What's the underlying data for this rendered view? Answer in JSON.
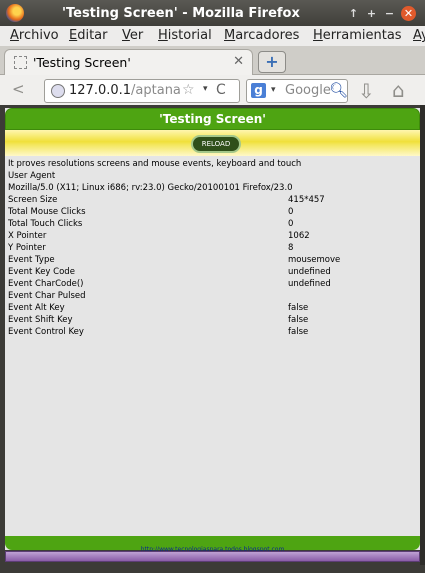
{
  "window": {
    "title": "'Testing Screen' - Mozilla Firefox",
    "buttons": [
      "↑",
      "+",
      "−",
      "✕"
    ]
  },
  "menu": [
    "Archivo",
    "Editar",
    "Ver",
    "Historial",
    "Marcadores",
    "Herramientas",
    "Ay"
  ],
  "tab": {
    "label": "'Testing Screen'",
    "close": "✕",
    "new_tab": "+"
  },
  "nav": {
    "back": "<",
    "url_host": "127.0.0.1",
    "url_path": "/aptana",
    "star": "☆",
    "dropdown": "▾",
    "reload": "C",
    "search_engine": "g",
    "search_placeholder": "Google",
    "search_icon": "magnifier-icon",
    "download_icon": "⇩",
    "home_icon": "⌂"
  },
  "page": {
    "title": "'Testing Screen'",
    "reload_button": "RELOAD",
    "description": "It proves resolutions screens and mouse events, keyboard and touch",
    "user_agent_label": "User Agent",
    "user_agent": "Mozilla/5.0 (X11; Linux i686; rv:23.0) Gecko/20100101 Firefox/23.0",
    "rows": [
      {
        "key": "Screen Size",
        "value": "415*457"
      },
      {
        "key": "Total Mouse Clicks",
        "value": "0"
      },
      {
        "key": "Total Touch Clicks",
        "value": "0"
      },
      {
        "key": "X Pointer",
        "value": "1062"
      },
      {
        "key": "Y Pointer",
        "value": "8"
      },
      {
        "key": "Event Type",
        "value": "mousemove"
      },
      {
        "key": "Event Key Code",
        "value": "undefined"
      },
      {
        "key": "Event CharCode()",
        "value": "undefined"
      },
      {
        "key": "Event Char Pulsed",
        "value": ""
      },
      {
        "key": "Event Alt Key",
        "value": "false"
      },
      {
        "key": "Event Shift Key",
        "value": "false"
      },
      {
        "key": "Event Control Key",
        "value": "false"
      }
    ],
    "footer_link": "http://www.tecnologiaspara.todos.blogspot.com"
  },
  "colors": {
    "header_green": "#4ea412",
    "header_yellow": "#f0e03a",
    "content_bg": "#e5e5e5"
  }
}
